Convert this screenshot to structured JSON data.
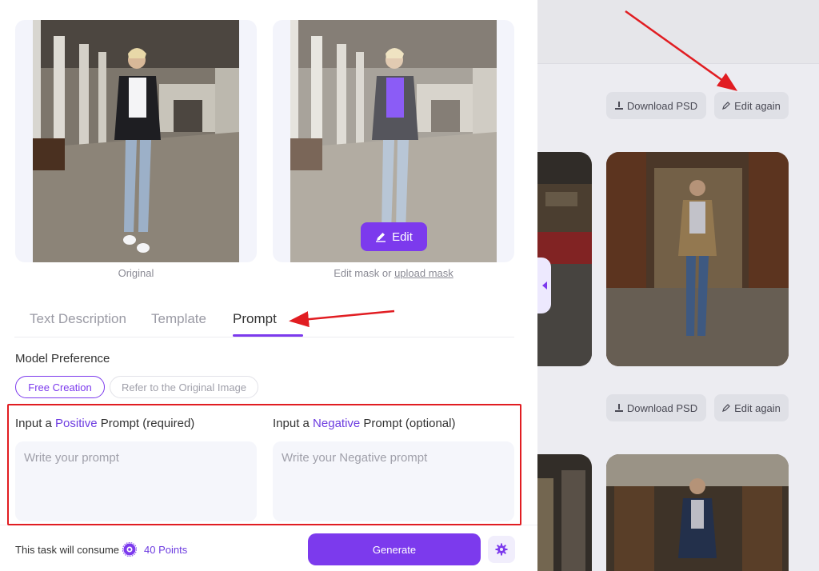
{
  "images": {
    "original_caption": "Original",
    "mask_caption_prefix": "Edit mask or ",
    "mask_caption_link": "upload mask",
    "edit_button": "Edit"
  },
  "tabs": [
    {
      "label": "Text Description",
      "active": false
    },
    {
      "label": "Template",
      "active": false
    },
    {
      "label": "Prompt",
      "active": true
    }
  ],
  "model_preference": {
    "label": "Model Preference",
    "options": [
      {
        "label": "Free Creation",
        "selected": true
      },
      {
        "label": "Refer to the Original Image",
        "selected": false
      }
    ]
  },
  "positive_prompt": {
    "label_before": "Input a ",
    "label_highlight": "Positive",
    "label_after": " Prompt (required)",
    "placeholder": "Write your prompt",
    "value": ""
  },
  "negative_prompt": {
    "label_before": "Input a ",
    "label_highlight": "Negative",
    "label_after": " Prompt (optional)",
    "placeholder": "Write your Negative prompt",
    "value": ""
  },
  "footer": {
    "consume_text": "This task will consume",
    "points_text": "40 Points",
    "generate_label": "Generate"
  },
  "results": {
    "download_label": "Download PSD",
    "edit_again_label": "Edit again"
  },
  "colors": {
    "accent": "#7c3aed",
    "annotation_red": "#e11d22"
  }
}
